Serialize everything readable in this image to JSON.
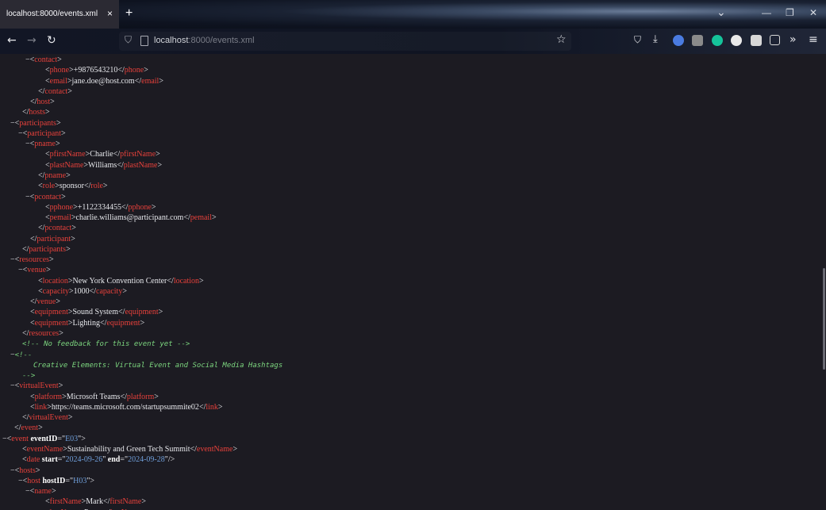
{
  "browser": {
    "tab_title": "localhost:8000/events.xml",
    "tab_close": "×",
    "new_tab": "+",
    "url_host": "localhost",
    "url_path": ":8000/events.xml",
    "chevron": "⌄",
    "minimize": "—",
    "restore": "❐",
    "close": "✕",
    "back": "←",
    "forward": "→",
    "reload": "↻",
    "shield": "⛉",
    "star": "☆",
    "pocket": "⛉",
    "download": "⤓",
    "ext_more": "»",
    "menu": "≡"
  },
  "xml_lines": [
    {
      "ind": 42,
      "fold": "−",
      "parts": [
        [
          "br",
          "<"
        ],
        [
          "tag",
          "contact"
        ],
        [
          "br",
          ">"
        ]
      ]
    },
    {
      "ind": 57,
      "parts": [
        [
          "br",
          "<"
        ],
        [
          "tag",
          "phone"
        ],
        [
          "br",
          ">"
        ],
        [
          "txt",
          "+9876543210"
        ],
        [
          "br",
          "</"
        ],
        [
          "tag",
          "phone"
        ],
        [
          "br",
          ">"
        ]
      ]
    },
    {
      "ind": 57,
      "parts": [
        [
          "br",
          "<"
        ],
        [
          "tag",
          "email"
        ],
        [
          "br",
          ">"
        ],
        [
          "txt",
          "jane.doe@host.com"
        ],
        [
          "br",
          "</"
        ],
        [
          "tag",
          "email"
        ],
        [
          "br",
          ">"
        ]
      ]
    },
    {
      "ind": 48,
      "parts": [
        [
          "br",
          "</"
        ],
        [
          "tag",
          "contact"
        ],
        [
          "br",
          ">"
        ]
      ]
    },
    {
      "ind": 38,
      "parts": [
        [
          "br",
          "</"
        ],
        [
          "tag",
          "host"
        ],
        [
          "br",
          ">"
        ]
      ]
    },
    {
      "ind": 28,
      "parts": [
        [
          "br",
          "</"
        ],
        [
          "tag",
          "hosts"
        ],
        [
          "br",
          ">"
        ]
      ]
    },
    {
      "ind": 23,
      "fold": "−",
      "parts": [
        [
          "br",
          "<"
        ],
        [
          "tag",
          "participants"
        ],
        [
          "br",
          ">"
        ]
      ]
    },
    {
      "ind": 33,
      "fold": "−",
      "parts": [
        [
          "br",
          "<"
        ],
        [
          "tag",
          "participant"
        ],
        [
          "br",
          ">"
        ]
      ]
    },
    {
      "ind": 42,
      "fold": "−",
      "parts": [
        [
          "br",
          "<"
        ],
        [
          "tag",
          "pname"
        ],
        [
          "br",
          ">"
        ]
      ]
    },
    {
      "ind": 57,
      "parts": [
        [
          "br",
          "<"
        ],
        [
          "tag",
          "pfirstName"
        ],
        [
          "br",
          ">"
        ],
        [
          "txt",
          "Charlie"
        ],
        [
          "br",
          "</"
        ],
        [
          "tag",
          "pfirstName"
        ],
        [
          "br",
          ">"
        ]
      ]
    },
    {
      "ind": 57,
      "parts": [
        [
          "br",
          "<"
        ],
        [
          "tag",
          "plastName"
        ],
        [
          "br",
          ">"
        ],
        [
          "txt",
          "Williams"
        ],
        [
          "br",
          "</"
        ],
        [
          "tag",
          "plastName"
        ],
        [
          "br",
          ">"
        ]
      ]
    },
    {
      "ind": 48,
      "parts": [
        [
          "br",
          "</"
        ],
        [
          "tag",
          "pname"
        ],
        [
          "br",
          ">"
        ]
      ]
    },
    {
      "ind": 48,
      "parts": [
        [
          "br",
          "<"
        ],
        [
          "tag",
          "role"
        ],
        [
          "br",
          ">"
        ],
        [
          "txt",
          "sponsor"
        ],
        [
          "br",
          "</"
        ],
        [
          "tag",
          "role"
        ],
        [
          "br",
          ">"
        ]
      ]
    },
    {
      "ind": 42,
      "fold": "−",
      "parts": [
        [
          "br",
          "<"
        ],
        [
          "tag",
          "pcontact"
        ],
        [
          "br",
          ">"
        ]
      ]
    },
    {
      "ind": 57,
      "parts": [
        [
          "br",
          "<"
        ],
        [
          "tag",
          "pphone"
        ],
        [
          "br",
          ">"
        ],
        [
          "txt",
          "+1122334455"
        ],
        [
          "br",
          "</"
        ],
        [
          "tag",
          "pphone"
        ],
        [
          "br",
          ">"
        ]
      ]
    },
    {
      "ind": 57,
      "parts": [
        [
          "br",
          "<"
        ],
        [
          "tag",
          "pemail"
        ],
        [
          "br",
          ">"
        ],
        [
          "txt",
          "charlie.williams@participant.com"
        ],
        [
          "br",
          "</"
        ],
        [
          "tag",
          "pemail"
        ],
        [
          "br",
          ">"
        ]
      ]
    },
    {
      "ind": 48,
      "parts": [
        [
          "br",
          "</"
        ],
        [
          "tag",
          "pcontact"
        ],
        [
          "br",
          ">"
        ]
      ]
    },
    {
      "ind": 38,
      "parts": [
        [
          "br",
          "</"
        ],
        [
          "tag",
          "participant"
        ],
        [
          "br",
          ">"
        ]
      ]
    },
    {
      "ind": 28,
      "parts": [
        [
          "br",
          "</"
        ],
        [
          "tag",
          "participants"
        ],
        [
          "br",
          ">"
        ]
      ]
    },
    {
      "ind": 23,
      "fold": "−",
      "parts": [
        [
          "br",
          "<"
        ],
        [
          "tag",
          "resources"
        ],
        [
          "br",
          ">"
        ]
      ]
    },
    {
      "ind": 33,
      "fold": "−",
      "parts": [
        [
          "br",
          "<"
        ],
        [
          "tag",
          "venue"
        ],
        [
          "br",
          ">"
        ]
      ]
    },
    {
      "ind": 48,
      "parts": [
        [
          "br",
          "<"
        ],
        [
          "tag",
          "location"
        ],
        [
          "br",
          ">"
        ],
        [
          "txt",
          "New York Convention Center"
        ],
        [
          "br",
          "</"
        ],
        [
          "tag",
          "location"
        ],
        [
          "br",
          ">"
        ]
      ]
    },
    {
      "ind": 48,
      "parts": [
        [
          "br",
          "<"
        ],
        [
          "tag",
          "capacity"
        ],
        [
          "br",
          ">"
        ],
        [
          "txt",
          "1000"
        ],
        [
          "br",
          "</"
        ],
        [
          "tag",
          "capacity"
        ],
        [
          "br",
          ">"
        ]
      ]
    },
    {
      "ind": 38,
      "parts": [
        [
          "br",
          "</"
        ],
        [
          "tag",
          "venue"
        ],
        [
          "br",
          ">"
        ]
      ]
    },
    {
      "ind": 38,
      "parts": [
        [
          "br",
          "<"
        ],
        [
          "tag",
          "equipment"
        ],
        [
          "br",
          ">"
        ],
        [
          "txt",
          "Sound System"
        ],
        [
          "br",
          "</"
        ],
        [
          "tag",
          "equipment"
        ],
        [
          "br",
          ">"
        ]
      ]
    },
    {
      "ind": 38,
      "parts": [
        [
          "br",
          "<"
        ],
        [
          "tag",
          "equipment"
        ],
        [
          "br",
          ">"
        ],
        [
          "txt",
          "Lighting"
        ],
        [
          "br",
          "</"
        ],
        [
          "tag",
          "equipment"
        ],
        [
          "br",
          ">"
        ]
      ]
    },
    {
      "ind": 28,
      "parts": [
        [
          "br",
          "</"
        ],
        [
          "tag",
          "resources"
        ],
        [
          "br",
          ">"
        ]
      ]
    },
    {
      "ind": 28,
      "parts": [
        [
          "com",
          "<!-- No feedback for this event yet -->"
        ]
      ]
    },
    {
      "ind": 23,
      "fold": "−",
      "parts": [
        [
          "com",
          "<!--"
        ]
      ]
    },
    {
      "ind": 42,
      "parts": [
        [
          "com",
          "Creative Elements: Virtual Event and Social Media Hashtags"
        ]
      ]
    },
    {
      "ind": 28,
      "parts": [
        [
          "com",
          "-->"
        ]
      ]
    },
    {
      "ind": 23,
      "fold": "−",
      "parts": [
        [
          "br",
          "<"
        ],
        [
          "tag",
          "virtualEvent"
        ],
        [
          "br",
          ">"
        ]
      ]
    },
    {
      "ind": 38,
      "parts": [
        [
          "br",
          "<"
        ],
        [
          "tag",
          "platform"
        ],
        [
          "br",
          ">"
        ],
        [
          "txt",
          "Microsoft Teams"
        ],
        [
          "br",
          "</"
        ],
        [
          "tag",
          "platform"
        ],
        [
          "br",
          ">"
        ]
      ]
    },
    {
      "ind": 38,
      "parts": [
        [
          "br",
          "<"
        ],
        [
          "tag",
          "link"
        ],
        [
          "br",
          ">"
        ],
        [
          "txt",
          "https://teams.microsoft.com/startupsummite02"
        ],
        [
          "br",
          "</"
        ],
        [
          "tag",
          "link"
        ],
        [
          "br",
          ">"
        ]
      ]
    },
    {
      "ind": 28,
      "parts": [
        [
          "br",
          "</"
        ],
        [
          "tag",
          "virtualEvent"
        ],
        [
          "br",
          ">"
        ]
      ]
    },
    {
      "ind": 18,
      "parts": [
        [
          "br",
          "</"
        ],
        [
          "tag",
          "event"
        ],
        [
          "br",
          ">"
        ]
      ]
    },
    {
      "ind": 13,
      "fold": "−",
      "parts": [
        [
          "br",
          "<"
        ],
        [
          "tag",
          "event"
        ],
        [
          "attr",
          " eventID"
        ],
        [
          "br",
          "=\""
        ],
        [
          "val",
          "E03"
        ],
        [
          "br",
          "\">"
        ]
      ]
    },
    {
      "ind": 28,
      "parts": [
        [
          "br",
          "<"
        ],
        [
          "tag",
          "eventName"
        ],
        [
          "br",
          ">"
        ],
        [
          "txt",
          "Sustainability and Green Tech Summit"
        ],
        [
          "br",
          "</"
        ],
        [
          "tag",
          "eventName"
        ],
        [
          "br",
          ">"
        ]
      ]
    },
    {
      "ind": 28,
      "parts": [
        [
          "br",
          "<"
        ],
        [
          "tag",
          "date"
        ],
        [
          "attr",
          " start"
        ],
        [
          "br",
          "=\""
        ],
        [
          "val",
          "2024-09-26"
        ],
        [
          "br",
          "\""
        ],
        [
          "attr",
          " end"
        ],
        [
          "br",
          "=\""
        ],
        [
          "val",
          "2024-09-28"
        ],
        [
          "br",
          "\"/>"
        ]
      ]
    },
    {
      "ind": 23,
      "fold": "−",
      "parts": [
        [
          "br",
          "<"
        ],
        [
          "tag",
          "hosts"
        ],
        [
          "br",
          ">"
        ]
      ]
    },
    {
      "ind": 33,
      "fold": "−",
      "parts": [
        [
          "br",
          "<"
        ],
        [
          "tag",
          "host"
        ],
        [
          "attr",
          " hostID"
        ],
        [
          "br",
          "=\""
        ],
        [
          "val",
          "H03"
        ],
        [
          "br",
          "\">"
        ]
      ]
    },
    {
      "ind": 42,
      "fold": "−",
      "parts": [
        [
          "br",
          "<"
        ],
        [
          "tag",
          "name"
        ],
        [
          "br",
          ">"
        ]
      ]
    },
    {
      "ind": 57,
      "parts": [
        [
          "br",
          "<"
        ],
        [
          "tag",
          "firstName"
        ],
        [
          "br",
          ">"
        ],
        [
          "txt",
          "Mark"
        ],
        [
          "br",
          "</"
        ],
        [
          "tag",
          "firstName"
        ],
        [
          "br",
          ">"
        ]
      ]
    },
    {
      "ind": 57,
      "parts": [
        [
          "br",
          "<"
        ],
        [
          "tag",
          "lastName"
        ],
        [
          "br",
          ">"
        ],
        [
          "txt",
          "Peters"
        ],
        [
          "br",
          "</"
        ],
        [
          "tag",
          "lastName"
        ],
        [
          "br",
          ">"
        ]
      ]
    }
  ]
}
